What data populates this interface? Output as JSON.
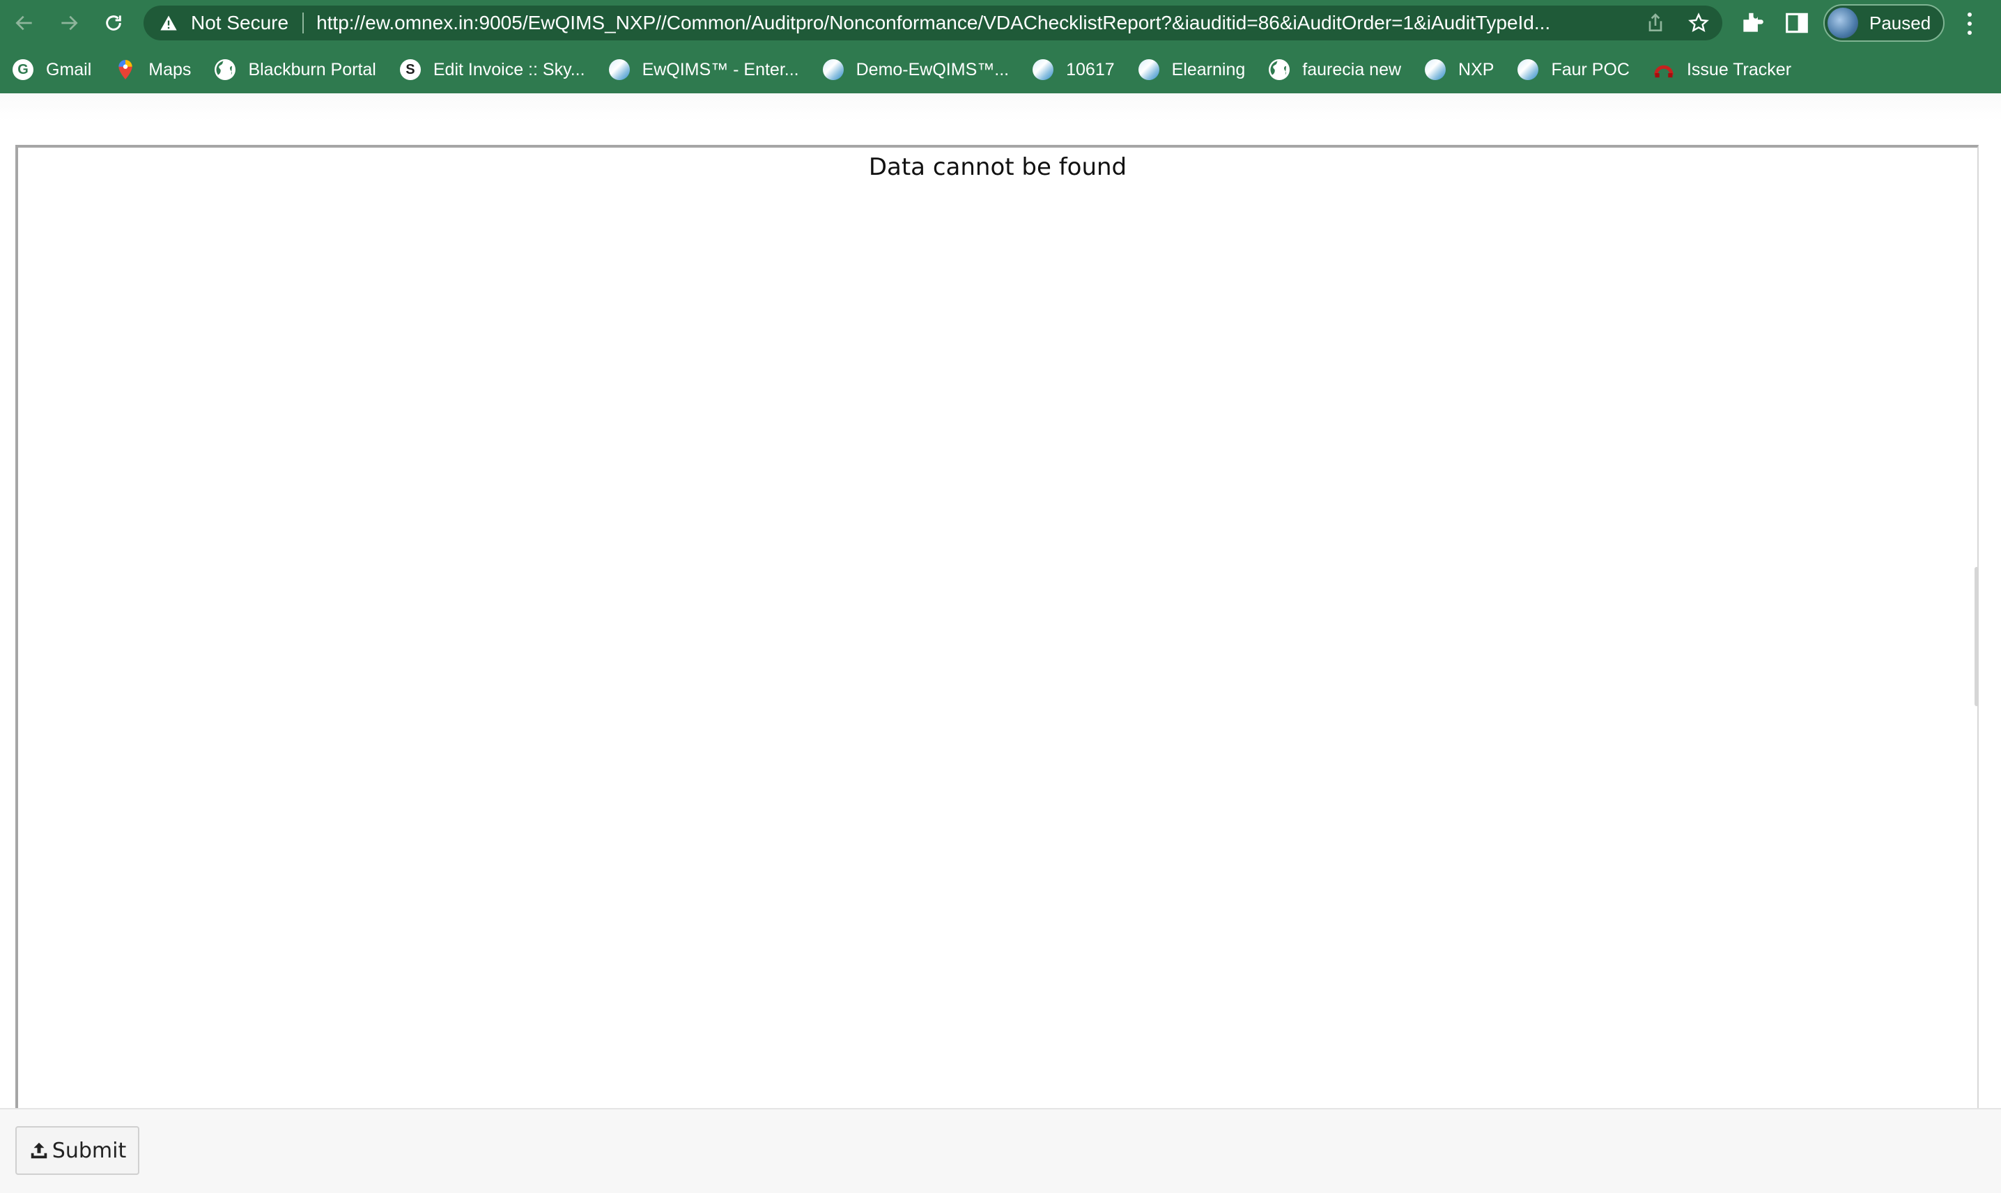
{
  "browser": {
    "security_label": "Not Secure",
    "url": "http://ew.omnex.in:9005/EwQIMS_NXP//Common/Auditpro/Nonconformance/VDAChecklistReport?&iauditid=86&iAuditOrder=1&iAuditTypeId...",
    "profile_label": "Paused",
    "theme_color": "#2f7a4f"
  },
  "bookmarks": [
    {
      "label": "Gmail",
      "icon": "google-icon"
    },
    {
      "label": "Maps",
      "icon": "maps-icon"
    },
    {
      "label": "Blackburn  Portal",
      "icon": "globe-icon"
    },
    {
      "label": "Edit Invoice :: Sky...",
      "icon": "skype-icon"
    },
    {
      "label": "EwQIMS™ - Enter...",
      "icon": "omnex-icon"
    },
    {
      "label": "Demo-EwQIMS™...",
      "icon": "omnex-icon"
    },
    {
      "label": "10617",
      "icon": "omnex-icon"
    },
    {
      "label": "Elearning",
      "icon": "omnex-icon"
    },
    {
      "label": "faurecia new",
      "icon": "globe-icon"
    },
    {
      "label": "NXP",
      "icon": "omnex-icon"
    },
    {
      "label": "Faur POC",
      "icon": "omnex-icon"
    },
    {
      "label": "Issue Tracker",
      "icon": "tracker-icon"
    }
  ],
  "report": {
    "message": "Data cannot be found"
  },
  "footer": {
    "submit_label": "Submit"
  }
}
